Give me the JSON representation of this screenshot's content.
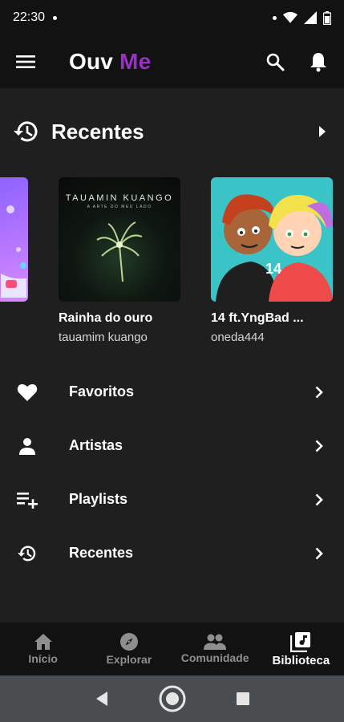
{
  "status_bar": {
    "time": "22:30"
  },
  "app_bar": {
    "title_main": "Ouv",
    "title_accent": "Me"
  },
  "recent_section": {
    "title": "Recentes"
  },
  "recent_items": [
    {
      "title": "Rainha do ouro",
      "artist": "tauamim kuango",
      "cover_text_1": "TAUAMIN KUANGO",
      "cover_text_2": "A ARTE DO MEU LADO"
    },
    {
      "title": "14 ft.YngBad ...",
      "artist": "oneda444",
      "cover_text_1": "14"
    }
  ],
  "menu": [
    {
      "label": "Favoritos",
      "icon": "heart-icon"
    },
    {
      "label": "Artistas",
      "icon": "person-icon"
    },
    {
      "label": "Playlists",
      "icon": "playlist-add-icon"
    },
    {
      "label": "Recentes",
      "icon": "history-icon"
    }
  ],
  "bottom_nav": [
    {
      "label": "Início",
      "icon": "home-icon"
    },
    {
      "label": "Explorar",
      "icon": "compass-icon"
    },
    {
      "label": "Comunidade",
      "icon": "people-icon"
    },
    {
      "label": "Biblioteca",
      "icon": "library-music-icon",
      "active": true
    }
  ],
  "colors": {
    "accent": "#9b30c8",
    "background": "#1f1f1f",
    "bar": "#121212"
  }
}
